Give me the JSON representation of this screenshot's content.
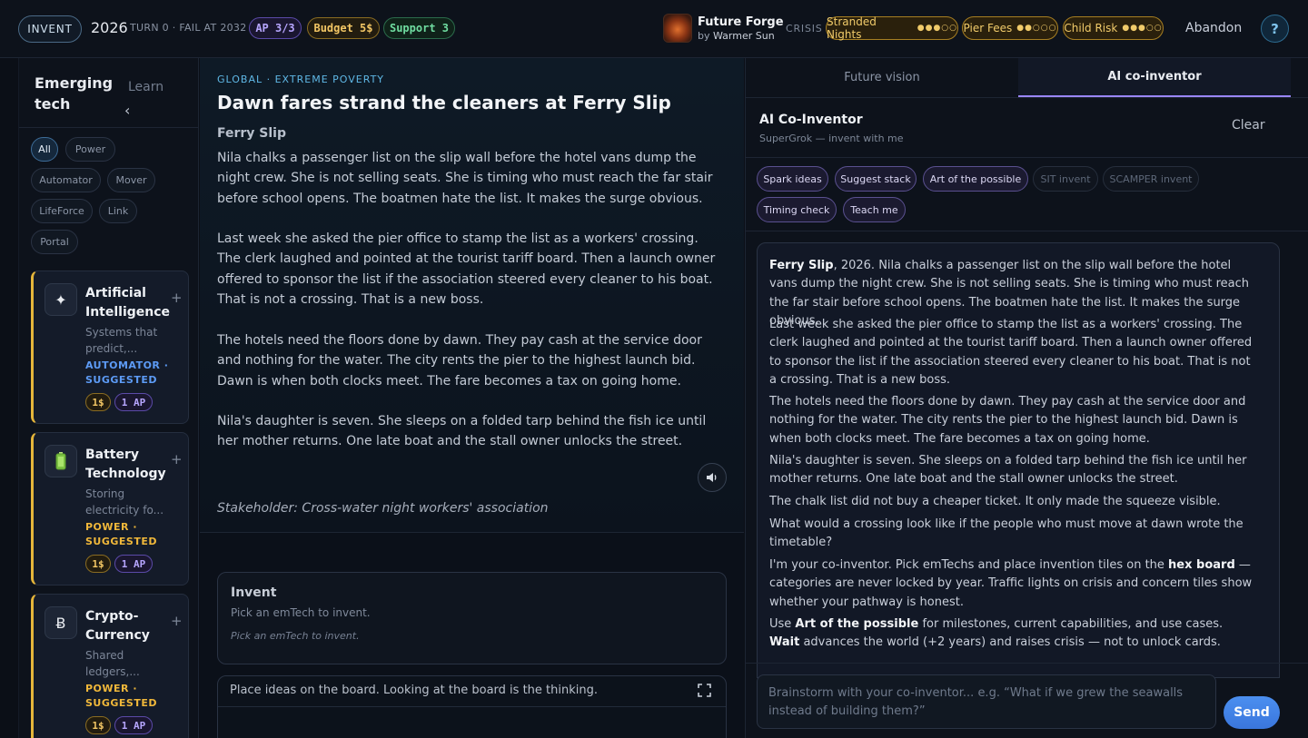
{
  "topbar": {
    "mode": "INVENT",
    "year": "2026",
    "turn_info": "TURN 0 · FAIL AT 2032",
    "ap": "AP 3/3",
    "budget": "Budget 5$",
    "support": "Support 3",
    "game_title": "Future Forge",
    "game_by_prefix": "by",
    "game_by_author": "Warmer Sun",
    "crisis_label": "CRISIS",
    "risks": [
      {
        "label": "Stranded Nights",
        "dots": "●●●○○",
        "level": 3,
        "max": 5
      },
      {
        "label": "Pier Fees",
        "dots": "●●○○○",
        "level": 2,
        "max": 5
      },
      {
        "label": "Child Risk",
        "dots": "●●●○○",
        "level": 3,
        "max": 5
      }
    ],
    "abandon": "Abandon",
    "help": "?"
  },
  "sidebar": {
    "tab_active": "Emerging tech",
    "tab_inactive": "Learn",
    "collapse_icon": "‹",
    "filters": [
      "All",
      "Power",
      "Automator",
      "Mover",
      "LifeForce",
      "Link",
      "Portal"
    ],
    "cards": [
      {
        "icon": "✦",
        "icon_name": "sparkle-icon",
        "name": "Artificial Intelligence",
        "desc": "Systems that predict,...",
        "category": "AUTOMATOR",
        "status": "SUGGESTED",
        "tag_color": "#5d9bf5",
        "cost": "1$",
        "ap": "1 AP"
      },
      {
        "icon": "🔋",
        "icon_name": "battery-icon",
        "name": "Battery Technology",
        "desc": "Storing electricity fo...",
        "category": "POWER",
        "status": "SUGGESTED",
        "tag_color": "#f1b83a",
        "cost": "1$",
        "ap": "1 AP"
      },
      {
        "icon": "Ƀ",
        "icon_name": "bitcoin-icon",
        "name": "Crypto-Currency",
        "desc": "Shared ledgers,...",
        "category": "POWER",
        "status": "SUGGESTED",
        "tag_color": "#f1b83a",
        "cost": "1$",
        "ap": "1 AP"
      }
    ]
  },
  "story": {
    "kicker": "GLOBAL · EXTREME POVERTY",
    "title": "Dawn fares strand the cleaners at Ferry Slip",
    "place": "Ferry Slip",
    "paragraphs": [
      "Nila chalks a passenger list on the slip wall before the hotel vans dump the night crew. She is not selling seats. She is timing who must reach the far stair before school opens. The boatmen hate the list. It makes the surge obvious.",
      "Last week she asked the pier office to stamp the list as a workers' crossing. The clerk laughed and pointed at the tourist tariff board. Then a launch owner offered to sponsor the list if the association steered every cleaner to his boat. That is not a crossing. That is a new boss.",
      "The hotels need the floors done by dawn. They pay cash at the service door and nothing for the water. The city rents the pier to the highest launch bid. Dawn is when both clocks meet. The fare becomes a tax on going home.",
      "Nila's daughter is seven. She sleeps on a folded tarp behind the fish ice until her mother returns. One late boat and the stall owner unlocks the street."
    ],
    "stakeholder": "Stakeholder: Cross-water night workers' association"
  },
  "invent": {
    "title": "Invent",
    "subtitle": "Pick an emTech to invent.",
    "hint": "Pick an emTech to invent."
  },
  "board": {
    "caption": "Place ideas on the board. Looking at the board is the thinking."
  },
  "right": {
    "tabs": [
      "Future vision",
      "AI co-inventor"
    ],
    "title": "AI Co-Inventor",
    "subtitle": "SuperGrok — invent with me",
    "clear": "Clear",
    "actions_enabled": [
      "Spark ideas",
      "Suggest stack",
      "Art of the possible",
      "Timing check",
      "Teach me"
    ],
    "actions_disabled": [
      "SIT invent",
      "SCAMPER invent"
    ],
    "chat": {
      "p1_bold": "Ferry Slip",
      "p1_rest": ", 2026. Nila chalks a passenger list on the slip wall before the hotel vans dump the night crew. She is not selling seats. She is timing who must reach the far stair before school opens. The boatmen hate the list. It makes the surge obvious.",
      "p2": "Last week she asked the pier office to stamp the list as a workers' crossing. The clerk laughed and pointed at the tourist tariff board. Then a launch owner offered to sponsor the list if the association steered every cleaner to his boat. That is not a crossing. That is a new boss.",
      "p3": "The hotels need the floors done by dawn. They pay cash at the service door and nothing for the water. The city rents the pier to the highest launch bid. Dawn is when both clocks meet. The fare becomes a tax on going home.",
      "p4": "Nila's daughter is seven. She sleeps on a folded tarp behind the fish ice until her mother returns. One late boat and the stall owner unlocks the street.",
      "p5": "The chalk list did not buy a cheaper ticket. It only made the squeeze visible.",
      "p6": "What would a crossing look like if the people who must move at dawn wrote the timetable?",
      "p7_a": "I'm your co-inventor. Pick emTechs and place invention tiles on the ",
      "p7_b": "hex board",
      "p7_c": " — categories are never locked by year. Traffic lights on crisis and concern tiles show whether your pathway is honest.",
      "p8_a": "Use ",
      "p8_b": "Art of the possible",
      "p8_c": " for milestones, current capabilities, and use cases. ",
      "p8_d": "Wait",
      "p8_e": " advances the world (+2 years) and raises crisis — not to unlock cards."
    },
    "composer_placeholder": "Brainstorm with your co-inventor... e.g. “What if we grew the seawalls instead of building them?”",
    "send": "Send"
  }
}
